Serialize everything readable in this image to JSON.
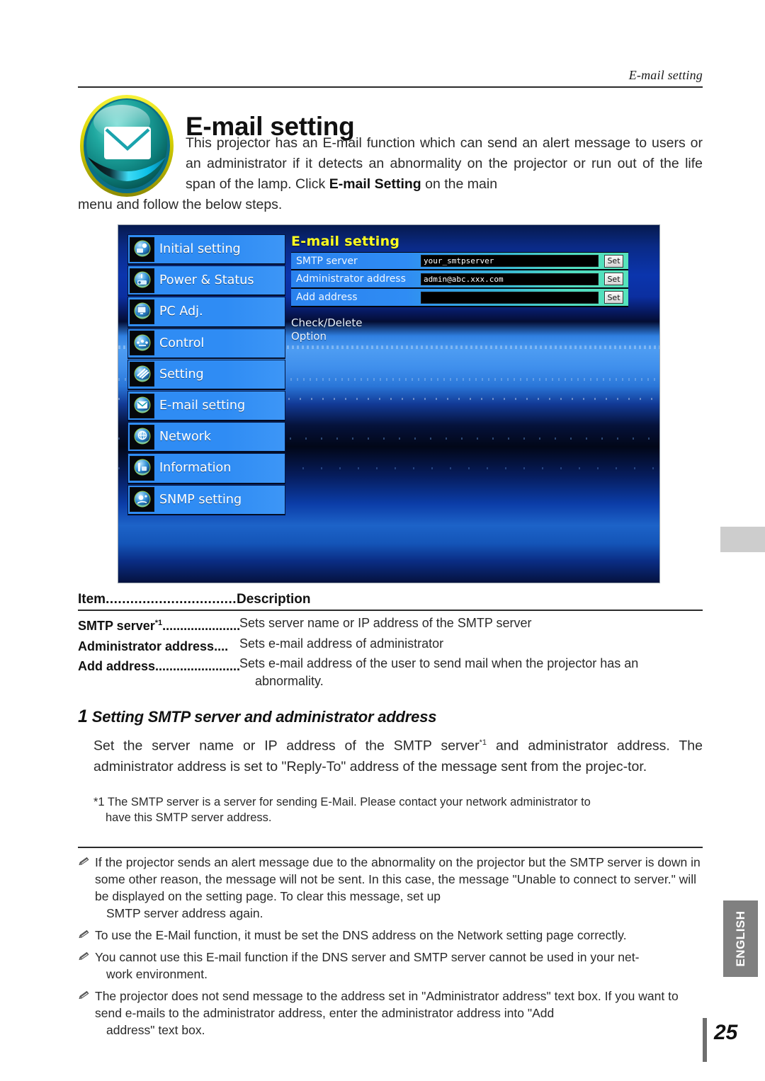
{
  "running_head": "E-mail setting",
  "title": "E-mail setting",
  "intro": {
    "part1": "This projector has an E-mail function which can send an alert message to users or an administrator if it detects an abnormality on the projector or run out of the life span of the lamp. Click ",
    "bold": "E-mail Setting",
    "part2": " on the main",
    "tail": "menu and follow the below steps."
  },
  "screenshot": {
    "nav": {
      "items": [
        {
          "label": "Initial setting",
          "icon": "initial-setting-icon"
        },
        {
          "label": "Power & Status",
          "icon": "power-status-icon"
        },
        {
          "label": "PC Adj.",
          "icon": "pc-adjust-icon"
        },
        {
          "label": "Control",
          "icon": "control-icon"
        },
        {
          "label": "Setting",
          "icon": "setting-icon"
        },
        {
          "label": "E-mail setting",
          "icon": "email-icon"
        },
        {
          "label": "Network",
          "icon": "network-icon"
        },
        {
          "label": "Information",
          "icon": "information-icon"
        },
        {
          "label": "SNMP setting",
          "icon": "snmp-icon"
        }
      ]
    },
    "pane": {
      "title": "E-mail setting",
      "fields": [
        {
          "label": "SMTP server",
          "value": "your_smtpserver",
          "button": "Set"
        },
        {
          "label": "Administrator address",
          "value": "admin@abc.xxx.com",
          "button": "Set"
        },
        {
          "label": "Add address",
          "value": "",
          "button": "Set"
        }
      ],
      "links": [
        "Check/Delete",
        "Option"
      ]
    },
    "colors": {
      "title_yellow": "#ffff21",
      "nav_blue": "#2f8cf4",
      "field_teal": "#4fdcc0"
    }
  },
  "table": {
    "head_item": "Item",
    "head_dots": "................................",
    "head_desc": "Description",
    "rows": [
      {
        "key": "SMTP server",
        "key_sup": "*1",
        "key_dots": ".......................",
        "desc": "Sets server name or IP address of the SMTP server",
        "desc_indent": ""
      },
      {
        "key": "Administrator address",
        "key_sup": "",
        "key_dots": "....",
        "desc": "Sets e-mail address of administrator",
        "desc_indent": ""
      },
      {
        "key": "Add address",
        "key_sup": "",
        "key_dots": ".........................",
        "desc": "Sets e-mail address of the user to send mail when  the projector has an",
        "desc_indent": "abnormality."
      }
    ]
  },
  "section": {
    "number": "1",
    "heading": "Setting SMTP server and administrator address",
    "body_a": "Set the server name or IP address of the SMTP server",
    "body_sup": "*1",
    "body_b": " and administrator address. The administrator address is set to \"Reply-To\" address of the message sent from the projec-",
    "body_c": "tor.",
    "footnote": "*1 The SMTP server is a server for sending E-Mail. Please contact your network administrator to",
    "footnote_indent": "have this SMTP server address."
  },
  "notes": [
    {
      "icon": "pencil-note-icon",
      "text": "If the projector sends an alert message due to the abnormality on the projector but the SMTP server is down in some other reason, the message will not be sent. In this case, the message \"Unable to connect to server.\" will be displayed on the setting page. To clear this message, set up",
      "indent": "SMTP server address again."
    },
    {
      "icon": "pencil-note-icon",
      "text": "To use the E-Mail function, it must be set the DNS address on the Network setting page correctly.",
      "indent": ""
    },
    {
      "icon": "pencil-note-icon",
      "text": "You cannot use this E-mail function if the DNS server and SMTP server cannot be used in your net-",
      "indent": "work environment."
    },
    {
      "icon": "pencil-note-icon",
      "text": "The projector does not send message to the address set in \"Administrator address\" text box. If you want to send e-mails to the administrator address, enter the administrator address into \"Add",
      "indent": "address\" text box."
    }
  ],
  "furniture": {
    "language": "ENGLISH",
    "page_number": "25"
  }
}
